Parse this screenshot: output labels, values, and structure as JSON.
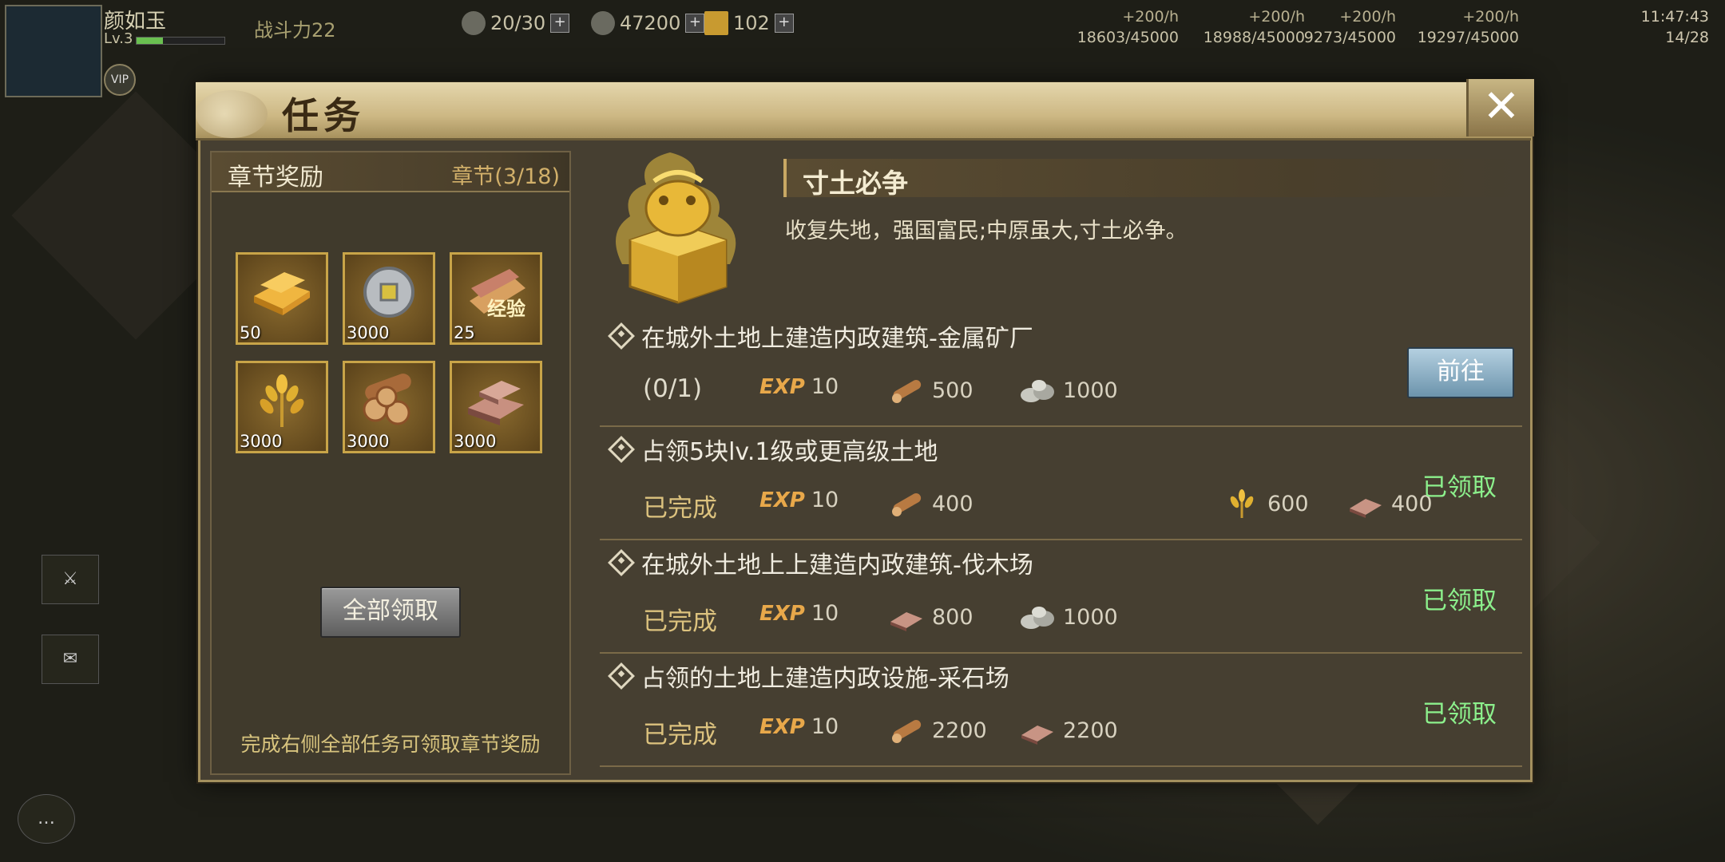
{
  "hud": {
    "player_name": "颜如玉",
    "player_level": "Lv.3",
    "vip": "VIP",
    "power": "战斗力22",
    "troops": "20/30",
    "coins": "47200",
    "gold": "102",
    "production": [
      {
        "rate": "+200/h",
        "total": "18603/45000"
      },
      {
        "rate": "+200/h",
        "total": "18988/45000"
      },
      {
        "rate": "+200/h",
        "total": "9273/45000"
      },
      {
        "rate": "+200/h",
        "total": "19297/45000"
      }
    ],
    "time": "11:47:43",
    "stamina": "14/28"
  },
  "panel": {
    "title": "任务",
    "close": "✕"
  },
  "chapter": {
    "header": "章节奖励",
    "count": "章节(3/18)",
    "rewards": [
      {
        "icon": "gold-bars-icon",
        "amount": "50"
      },
      {
        "icon": "coin-icon",
        "amount": "3000"
      },
      {
        "icon": "exp-scroll-icon",
        "amount": "25"
      },
      {
        "icon": "wheat-icon",
        "amount": "3000"
      },
      {
        "icon": "wood-logs-icon",
        "amount": "3000"
      },
      {
        "icon": "iron-ingot-icon",
        "amount": "3000"
      }
    ],
    "claim_all": "全部领取",
    "footer": "完成右侧全部任务可领取章节奖励"
  },
  "main": {
    "chapter_title": "寸土必争",
    "chapter_desc": "收复失地，强国富民;中原虽大,寸土必争。"
  },
  "tasks": [
    {
      "name": "在城外土地上建造内政建筑-金属矿厂",
      "status": "(0/1)",
      "exp_label": "EXP",
      "exp": "10",
      "rewards": [
        {
          "icon": "wood-icon",
          "amount": "500"
        },
        {
          "icon": "stone-icon",
          "amount": "1000"
        }
      ],
      "action": "前往"
    },
    {
      "name": "占领5块lv.1级或更高级土地",
      "status": "已完成",
      "exp_label": "EXP",
      "exp": "10",
      "rewards": [
        {
          "icon": "wood-icon",
          "amount": "400"
        },
        {
          "icon": "wheat-icon",
          "amount": "600"
        },
        {
          "icon": "iron-icon",
          "amount": "400"
        }
      ],
      "action": "已领取"
    },
    {
      "name": "在城外土地上上建造内政建筑-伐木场",
      "status": "已完成",
      "exp_label": "EXP",
      "exp": "10",
      "rewards": [
        {
          "icon": "iron-icon",
          "amount": "800"
        },
        {
          "icon": "stone-icon",
          "amount": "1000"
        }
      ],
      "action": "已领取"
    },
    {
      "name": "占领的土地上建造内政设施-采石场",
      "status": "已完成",
      "exp_label": "EXP",
      "exp": "10",
      "rewards": [
        {
          "icon": "wood-icon",
          "amount": "2200"
        },
        {
          "icon": "iron-icon",
          "amount": "2200"
        }
      ],
      "action": "已领取"
    }
  ],
  "colors": {
    "claimed": "#8cf08c",
    "accent_gold": "#d2b06a",
    "exp": "#e8a84a"
  }
}
